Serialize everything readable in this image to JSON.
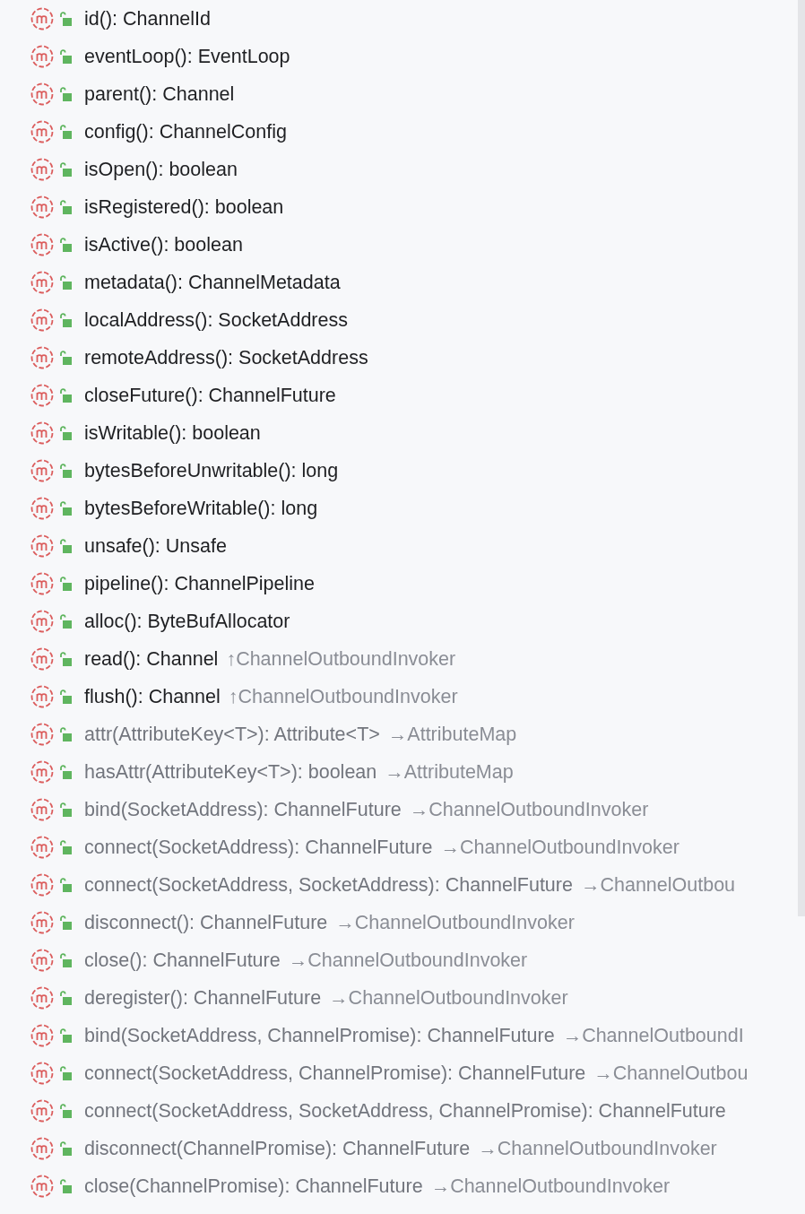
{
  "members": [
    {
      "signature": "id(): ChannelId",
      "inherited": false
    },
    {
      "signature": "eventLoop(): EventLoop",
      "inherited": false
    },
    {
      "signature": "parent(): Channel",
      "inherited": false
    },
    {
      "signature": "config(): ChannelConfig",
      "inherited": false
    },
    {
      "signature": "isOpen(): boolean",
      "inherited": false
    },
    {
      "signature": "isRegistered(): boolean",
      "inherited": false
    },
    {
      "signature": "isActive(): boolean",
      "inherited": false
    },
    {
      "signature": "metadata(): ChannelMetadata",
      "inherited": false
    },
    {
      "signature": "localAddress(): SocketAddress",
      "inherited": false
    },
    {
      "signature": "remoteAddress(): SocketAddress",
      "inherited": false
    },
    {
      "signature": "closeFuture(): ChannelFuture",
      "inherited": false
    },
    {
      "signature": "isWritable(): boolean",
      "inherited": false
    },
    {
      "signature": "bytesBeforeUnwritable(): long",
      "inherited": false
    },
    {
      "signature": "bytesBeforeWritable(): long",
      "inherited": false
    },
    {
      "signature": "unsafe(): Unsafe",
      "inherited": false
    },
    {
      "signature": "pipeline(): ChannelPipeline",
      "inherited": false
    },
    {
      "signature": "alloc(): ByteBufAllocator",
      "inherited": false
    },
    {
      "signature": "read(): Channel",
      "inherited": false,
      "origin": "↑ChannelOutboundInvoker"
    },
    {
      "signature": "flush(): Channel",
      "inherited": false,
      "origin": "↑ChannelOutboundInvoker"
    },
    {
      "signature": "attr(AttributeKey<T>): Attribute<T>",
      "inherited": true,
      "origin": "→AttributeMap"
    },
    {
      "signature": "hasAttr(AttributeKey<T>): boolean",
      "inherited": true,
      "origin": "→AttributeMap"
    },
    {
      "signature": "bind(SocketAddress): ChannelFuture",
      "inherited": true,
      "origin": "→ChannelOutboundInvoker"
    },
    {
      "signature": "connect(SocketAddress): ChannelFuture",
      "inherited": true,
      "origin": "→ChannelOutboundInvoker"
    },
    {
      "signature": "connect(SocketAddress, SocketAddress): ChannelFuture",
      "inherited": true,
      "origin": "→ChannelOutbou"
    },
    {
      "signature": "disconnect(): ChannelFuture",
      "inherited": true,
      "origin": "→ChannelOutboundInvoker"
    },
    {
      "signature": "close(): ChannelFuture",
      "inherited": true,
      "origin": "→ChannelOutboundInvoker"
    },
    {
      "signature": "deregister(): ChannelFuture",
      "inherited": true,
      "origin": "→ChannelOutboundInvoker"
    },
    {
      "signature": "bind(SocketAddress, ChannelPromise): ChannelFuture",
      "inherited": true,
      "origin": "→ChannelOutboundI"
    },
    {
      "signature": "connect(SocketAddress, ChannelPromise): ChannelFuture",
      "inherited": true,
      "origin": "→ChannelOutbou"
    },
    {
      "signature": "connect(SocketAddress, SocketAddress, ChannelPromise): ChannelFuture",
      "inherited": true
    },
    {
      "signature": "disconnect(ChannelPromise): ChannelFuture",
      "inherited": true,
      "origin": "→ChannelOutboundInvoker"
    },
    {
      "signature": "close(ChannelPromise): ChannelFuture",
      "inherited": true,
      "origin": "→ChannelOutboundInvoker"
    }
  ]
}
